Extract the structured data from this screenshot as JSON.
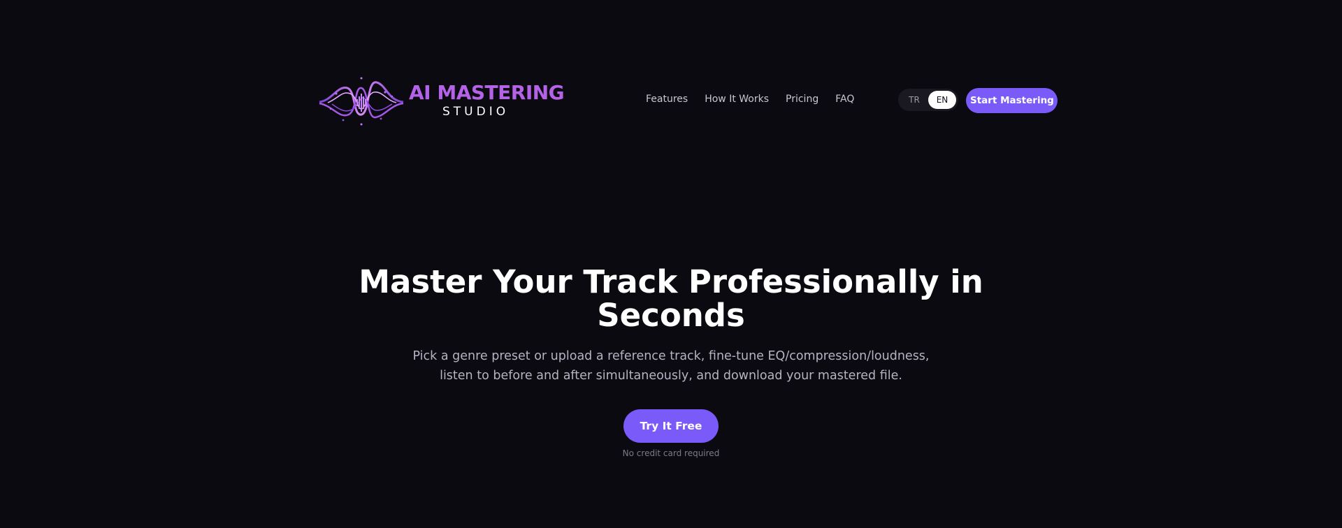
{
  "colors": {
    "background": "#0b0a10",
    "accent": "#7a5af8",
    "brand_purple": "#b463e6",
    "nav_text": "#c9c6d3",
    "muted_text": "#b7b3c3"
  },
  "brand": {
    "logo_icon": "soundwave-logo-icon",
    "title": "AI MASTERING",
    "subtitle": "STUDIO"
  },
  "nav": {
    "items": [
      {
        "label": "Features"
      },
      {
        "label": "How It Works"
      },
      {
        "label": "Pricing"
      },
      {
        "label": "FAQ"
      }
    ]
  },
  "language": {
    "options": [
      "TR",
      "EN"
    ],
    "selected": "EN"
  },
  "header": {
    "cta_label": "Start Mastering"
  },
  "hero": {
    "title": "Master Your Track Professionally in Seconds",
    "subtitle": "Pick a genre preset or upload a reference track, fine-tune EQ/compression/loudness, listen to before and after simultaneously, and download your mastered file.",
    "cta_label": "Try It Free",
    "note": "No credit card required"
  }
}
